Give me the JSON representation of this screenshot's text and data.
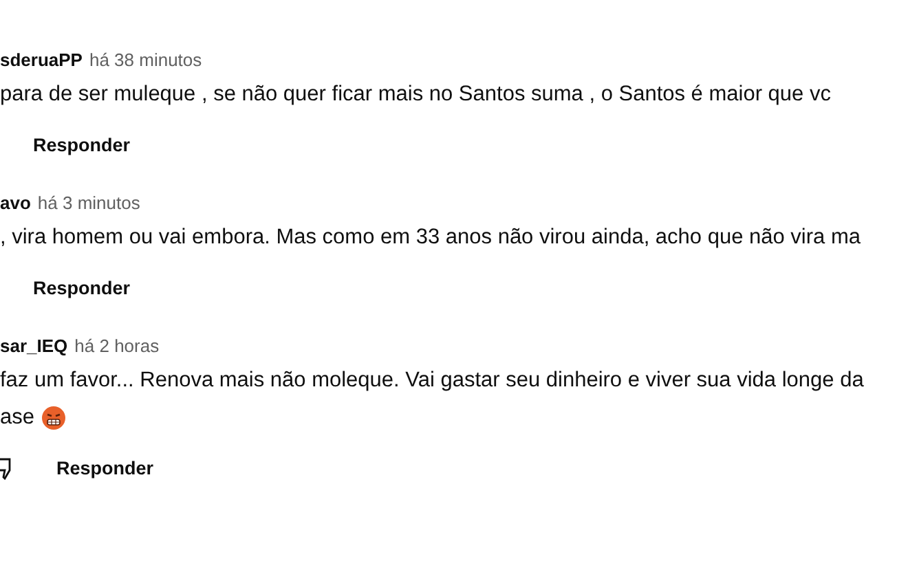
{
  "comments": [
    {
      "author": "sderuaPP",
      "time": "há 38 minutos",
      "lines": [
        "para de ser muleque , se não quer ficar mais no Santos suma , o Santos é maior que vc"
      ],
      "emoji": false,
      "dislike_icon": false,
      "reply": "Responder"
    },
    {
      "author": "avo",
      "time": "há 3 minutos",
      "lines": [
        ", vira homem ou vai embora. Mas como em 33 anos não virou ainda, acho que não vira ma"
      ],
      "emoji": false,
      "dislike_icon": false,
      "reply": "Responder"
    },
    {
      "author": "sar_IEQ",
      "time": "há 2 horas",
      "lines": [
        "faz um favor... Renova mais não moleque. Vai gastar seu dinheiro e viver sua vida longe da",
        "ase"
      ],
      "emoji": true,
      "dislike_icon": true,
      "reply": "Responder"
    }
  ]
}
